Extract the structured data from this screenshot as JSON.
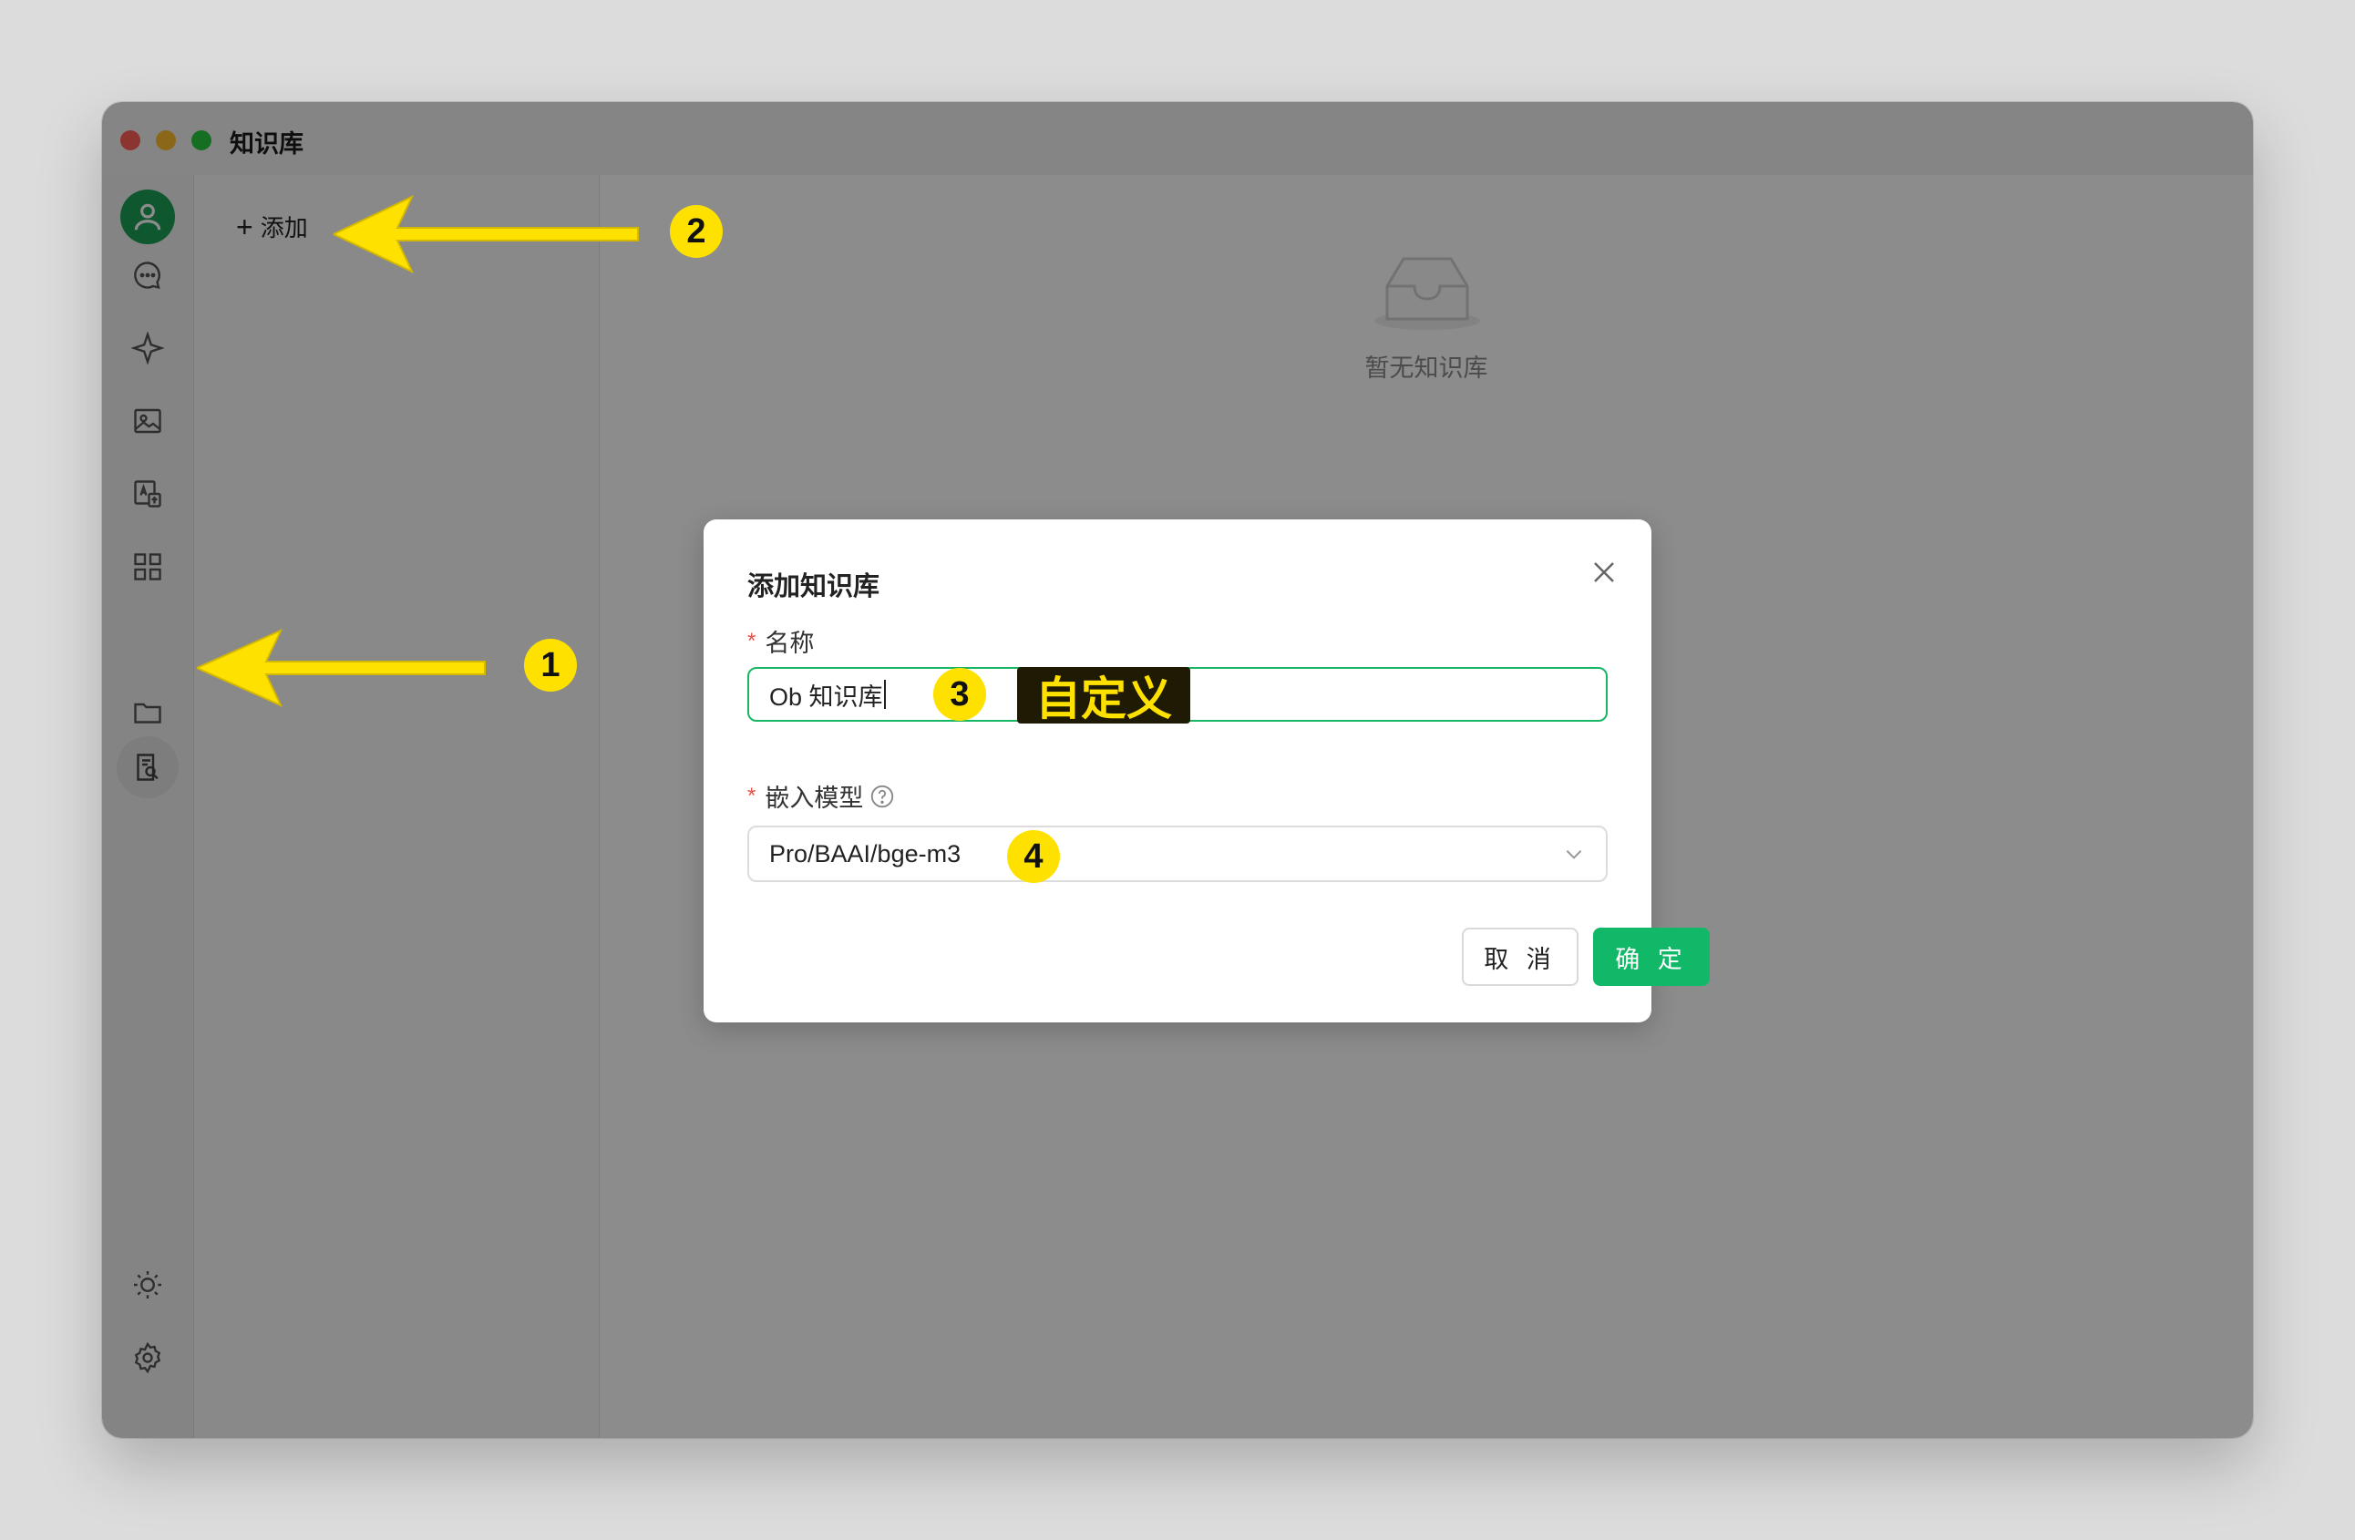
{
  "window": {
    "title": "知识库"
  },
  "sidebar": {
    "items": [
      {
        "name": "avatar",
        "icon": "user-icon"
      },
      {
        "name": "chat",
        "icon": "chat-bubble-icon"
      },
      {
        "name": "assistant",
        "icon": "sparkle-icon"
      },
      {
        "name": "image",
        "icon": "image-icon"
      },
      {
        "name": "translate",
        "icon": "translate-icon"
      },
      {
        "name": "apps",
        "icon": "grid-icon"
      },
      {
        "name": "knowledge",
        "icon": "knowledge-icon",
        "active": true
      },
      {
        "name": "files",
        "icon": "folder-icon"
      },
      {
        "name": "theme",
        "icon": "sun-icon"
      },
      {
        "name": "settings",
        "icon": "gear-icon"
      }
    ]
  },
  "list_pane": {
    "add_label": "添加"
  },
  "main": {
    "empty_text": "暂无知识库"
  },
  "dialog": {
    "title": "添加知识库",
    "name_label": "名称",
    "name_value": "Ob 知识库",
    "model_label": "嵌入模型",
    "model_value": "Pro/BAAI/bge-m3",
    "cancel_label": "取 消",
    "ok_label": "确 定"
  },
  "annotations": {
    "badges": [
      "1",
      "2",
      "3",
      "4"
    ],
    "tag_text": "自定义"
  },
  "colors": {
    "accent": "#11b868",
    "annotation_yellow": "#ffe100",
    "required": "#e8504a"
  }
}
